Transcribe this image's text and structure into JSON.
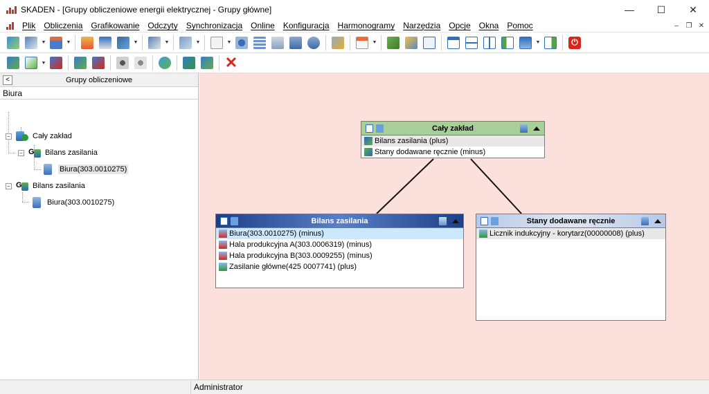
{
  "window": {
    "title": "SKADEN - [Grupy obliczeniowe energii elektrycznej - Grupy główne]",
    "controls": {
      "minimize": "—",
      "maximize": "☐",
      "close": "✕"
    }
  },
  "menu": {
    "items": [
      "Plik",
      "Obliczenia",
      "Grafikowanie",
      "Odczyty",
      "Synchronizacja",
      "Online",
      "Konfiguracja",
      "Harmonogramy",
      "Narzędzia",
      "Opcje",
      "Okna",
      "Pomoc"
    ],
    "mdi_controls": {
      "minimize": "–",
      "restore": "❐",
      "close": "✕"
    }
  },
  "left_panel": {
    "back_button": "<",
    "title": "Grupy obliczeniowe",
    "search_value": "Biura",
    "tree": [
      {
        "label": "Cały zakład",
        "toggle": "−",
        "icon": "group-icon"
      },
      {
        "label": "Bilans zasilania",
        "toggle": "−",
        "icon": "balance-group-icon"
      },
      {
        "label": "Biura(303.0010275)",
        "icon": "meter-icon",
        "selected": true
      },
      {
        "label": "Bilans zasilania",
        "toggle": "−",
        "icon": "balance-group-icon"
      },
      {
        "label": "Biura(303.0010275)",
        "icon": "meter-icon"
      }
    ]
  },
  "diagram": {
    "nodes": [
      {
        "title": "Cały zakład",
        "header_color": "#a8cf98",
        "rows": [
          {
            "text": "Bilans zasilania (plus)",
            "highlight": "grey"
          },
          {
            "text": "Stany dodawane ręcznie (minus)",
            "highlight": "none"
          }
        ]
      },
      {
        "title": "Bilans zasilania",
        "header_color": "#2b4a8f",
        "header_text_color": "#ffffff",
        "rows": [
          {
            "text": "Biura(303.0010275) (minus)",
            "highlight": "selected"
          },
          {
            "text": "Hala produkcyjna A(303.0006319) (minus)",
            "highlight": "none"
          },
          {
            "text": "Hala produkcyjna B(303.0009255) (minus)",
            "highlight": "none"
          },
          {
            "text": "Zasilanie główne(425 0007741) (plus)",
            "highlight": "none"
          }
        ]
      },
      {
        "title": "Stany dodawane ręcznie",
        "header_color": "#c8d6ec",
        "rows": [
          {
            "text": "Licznik indukcyjny - korytarz(00000008) (plus)",
            "highlight": "grey"
          }
        ]
      }
    ]
  },
  "status_bar": {
    "user": "Administrator"
  },
  "colors": {
    "canvas_bg": "#fbe0dc",
    "selection": "#cce8ff",
    "close_button_red": "#d9261c"
  }
}
